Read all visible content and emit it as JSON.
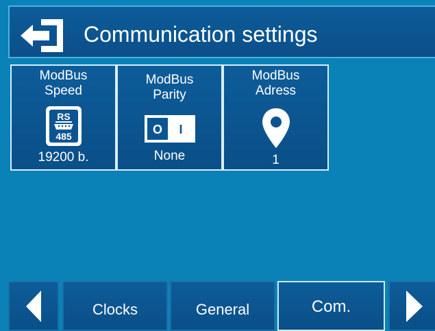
{
  "header": {
    "title": "Communication settings",
    "back_icon": "back-arrow-icon"
  },
  "tiles": [
    {
      "line1": "ModBus",
      "line2": "Speed",
      "value": "19200 b.",
      "icon": "rs485-icon",
      "icon_text_top": "RS",
      "icon_text_bottom": "485"
    },
    {
      "line1": "ModBus",
      "line2": "Parity",
      "value": "None",
      "icon": "toggle-switch-icon",
      "switch_off": "O",
      "switch_on": "I"
    },
    {
      "line1": "ModBus",
      "line2": "Adress",
      "value": "1",
      "icon": "location-pin-icon"
    }
  ],
  "nav": {
    "prev_icon": "triangle-left-icon",
    "tabs": [
      "Clocks",
      "General",
      "Com."
    ],
    "active_tab": "Com.",
    "next_icon": "triangle-right-icon"
  },
  "colors": {
    "background": "#0a82b8",
    "panel": "#0b5592",
    "text": "#ffffff",
    "border_active": "#d8eef8"
  }
}
